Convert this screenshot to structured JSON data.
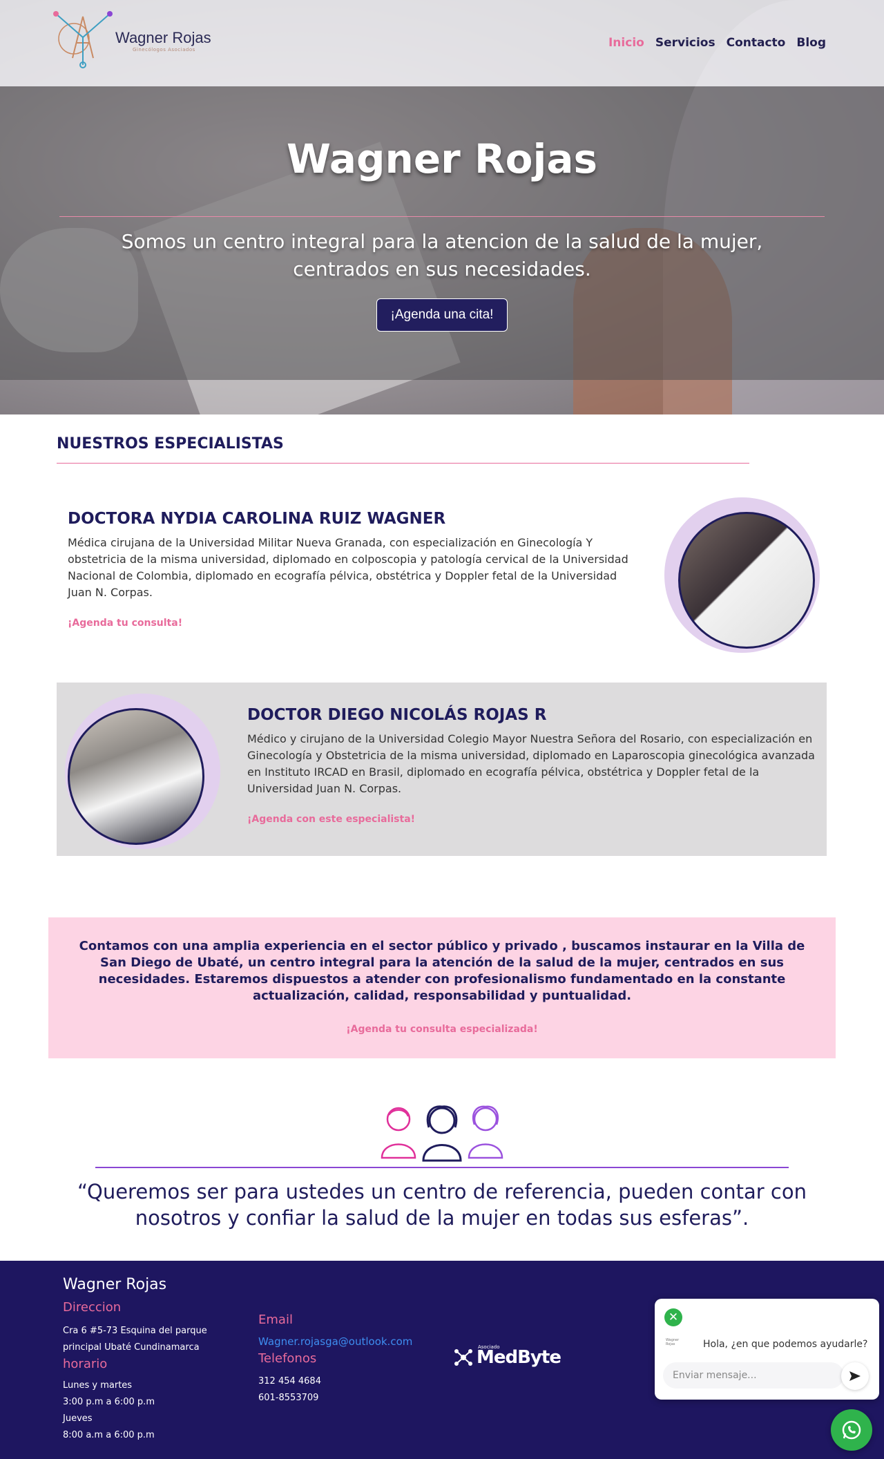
{
  "brand": {
    "name": "Wagner Rojas",
    "subtitle": "Ginecólogos Asociados"
  },
  "nav": {
    "items": [
      {
        "label": "Inicio",
        "active": true
      },
      {
        "label": "Servicios",
        "active": false
      },
      {
        "label": "Contacto",
        "active": false
      },
      {
        "label": "Blog",
        "active": false
      }
    ]
  },
  "hero": {
    "title": "Wagner Rojas",
    "subtitle": "Somos un centro integral para la atencion de la salud de la mujer, centrados en sus necesidades.",
    "cta": "¡Agenda una cita!"
  },
  "specialists": {
    "title": "NUESTROS ESPECIALISTAS",
    "doctors": [
      {
        "name": "DOCTORA NYDIA CAROLINA RUIZ WAGNER",
        "bio": "Médica cirujana de la Universidad Militar Nueva Granada, con especialización en Ginecología Y obstetricia de la misma universidad, diplomado en colposcopia y patología cervical de la Universidad Nacional de Colombia, diplomado en ecografía pélvica, obstétrica y Doppler fetal de la Universidad Juan N. Corpas.",
        "link": "¡Agenda tu consulta!"
      },
      {
        "name": "DOCTOR DIEGO NICOLÁS ROJAS R",
        "bio": "Médico y cirujano de la Universidad Colegio Mayor Nuestra Señora del Rosario, con especialización en Ginecología y Obstetricia de la misma universidad, diplomado en Laparoscopia ginecológica avanzada en Instituto IRCAD en Brasil, diplomado en ecografía pélvica, obstétrica y Doppler fetal de la Universidad Juan N. Corpas.",
        "link": "¡Agenda con este especialista!"
      }
    ]
  },
  "experience": {
    "text": "Contamos con una amplia experiencia en el sector público y privado , buscamos instaurar en la Villa de San Diego de Ubaté, un centro integral para la atención de la salud de la mujer, centrados en sus necesidades. Estaremos dispuestos a atender con profesionalismo fundamentado en la constante actualización, calidad, responsabilidad y puntualidad.",
    "link": "¡Agenda tu consulta especializada!"
  },
  "quote": {
    "text": "“Queremos ser para ustedes un centro de referencia, pueden contar con nosotros y confiar la salud de la mujer en todas sus esferas”."
  },
  "footer": {
    "brand": "Wagner Rojas",
    "address_title": "Direccion",
    "address_lines": [
      "Cra 6 #5-73 Esquina del parque",
      "principal Ubaté Cundinamarca"
    ],
    "hours_title": "horario",
    "hours_lines": [
      "Lunes y martes",
      "3:00 p.m a 6:00 p.m",
      "Jueves",
      "8:00 a.m a 6:00 p.m"
    ],
    "email_title": "Email",
    "email": "Wagner.rojasga@outlook.com",
    "phones_title": "Telefonos",
    "phones": [
      "312 454 4684",
      "601-8553709"
    ],
    "partner_small": "Asociado",
    "partner": "MedByte"
  },
  "chat": {
    "logo_text": "Wagner Rojas",
    "message": "Hola, ¿en que podemos ayudarle?",
    "placeholder": "Enviar mensaje..."
  },
  "colors": {
    "primary": "#1f1c5c",
    "accent": "#e86b9b",
    "footer_bg": "#1e1660",
    "pink_box": "#fdd4e4",
    "whatsapp": "#2fb34c"
  },
  "icons": [
    "women-group-icon",
    "whatsapp-icon",
    "send-icon",
    "close-icon"
  ]
}
